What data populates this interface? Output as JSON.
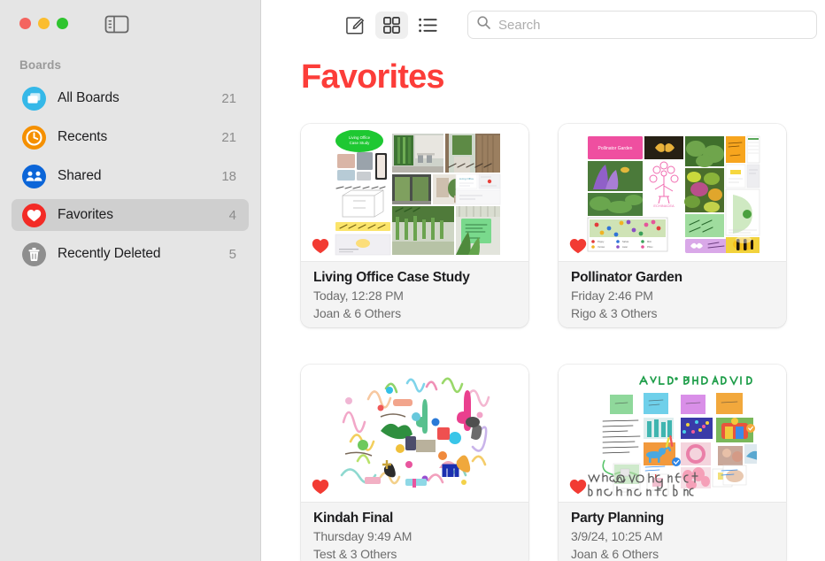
{
  "window": {
    "traffic_lights": [
      "close",
      "minimize",
      "zoom"
    ],
    "sidebar_toggle_icon": "sidebar-toggle-icon"
  },
  "sidebar": {
    "section_header": "Boards",
    "items": [
      {
        "label": "All Boards",
        "count": "21",
        "icon": "all-boards-icon",
        "color": "#35b8e8",
        "selected": false
      },
      {
        "label": "Recents",
        "count": "21",
        "icon": "clock-icon",
        "color": "#f59000",
        "selected": false
      },
      {
        "label": "Shared",
        "count": "18",
        "icon": "people-icon",
        "color": "#0b65d8",
        "selected": false
      },
      {
        "label": "Favorites",
        "count": "4",
        "icon": "heart-icon",
        "color": "#f32b26",
        "selected": true
      },
      {
        "label": "Recently Deleted",
        "count": "5",
        "icon": "trash-icon",
        "color": "#8e8e8e",
        "selected": false
      }
    ]
  },
  "toolbar": {
    "compose_label": "compose-icon",
    "grid_view_label": "grid-view-icon",
    "list_view_label": "list-view-icon",
    "grid_view_active": true,
    "search": {
      "value": "",
      "placeholder": "Search",
      "icon": "search-icon"
    }
  },
  "main": {
    "title": "Favorites",
    "title_color": "#fc3d39",
    "cards": [
      {
        "title": "Living Office Case Study",
        "date": "Today, 12:28 PM",
        "people": "Joan & 6 Others",
        "favorite": true,
        "thumb": "living-office-collage"
      },
      {
        "title": "Pollinator Garden",
        "date": "Friday 2:46 PM",
        "people": "Rigo & 3 Others",
        "favorite": true,
        "thumb": "pollinator-garden-collage"
      },
      {
        "title": "Kindah Final",
        "date": "Thursday 9:49 AM",
        "people": "Test & 3 Others",
        "favorite": true,
        "thumb": "kindah-doodle"
      },
      {
        "title": "Party Planning",
        "date": "3/9/24, 10:25 AM",
        "people": "Joan & 6 Others",
        "favorite": true,
        "thumb": "party-planning-board"
      }
    ]
  }
}
